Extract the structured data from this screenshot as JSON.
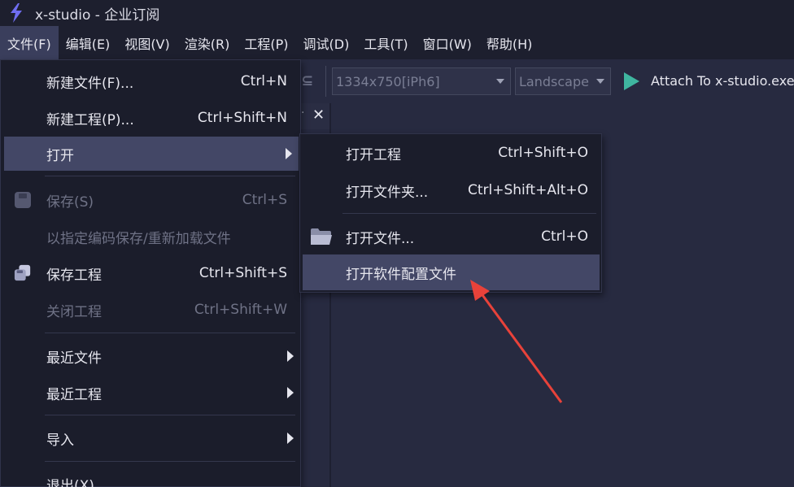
{
  "window": {
    "title": "x-studio - 企业订阅"
  },
  "menubar": {
    "items": [
      {
        "label": "文件(F)"
      },
      {
        "label": "编辑(E)"
      },
      {
        "label": "视图(V)"
      },
      {
        "label": "渲染(R)"
      },
      {
        "label": "工程(P)"
      },
      {
        "label": "调试(D)"
      },
      {
        "label": "工具(T)"
      },
      {
        "label": "窗口(W)"
      },
      {
        "label": "帮助(H)"
      }
    ]
  },
  "toolbar": {
    "resolution_value": "1334x750[iPh6]",
    "orientation_value": "Landscape",
    "attach_label": "Attach To x-studio.exe"
  },
  "file_menu": {
    "items": [
      {
        "label": "新建文件(F)...",
        "shortcut": "Ctrl+N"
      },
      {
        "label": "新建工程(P)...",
        "shortcut": "Ctrl+Shift+N"
      },
      {
        "label": "打开",
        "shortcut": ""
      },
      {
        "label": "保存(S)",
        "shortcut": "Ctrl+S"
      },
      {
        "label": "以指定编码保存/重新加载文件",
        "shortcut": ""
      },
      {
        "label": "保存工程",
        "shortcut": "Ctrl+Shift+S"
      },
      {
        "label": "关闭工程",
        "shortcut": "Ctrl+Shift+W"
      },
      {
        "label": "最近文件",
        "shortcut": ""
      },
      {
        "label": "最近工程",
        "shortcut": ""
      },
      {
        "label": "导入",
        "shortcut": ""
      },
      {
        "label": "退出(X)",
        "shortcut": ""
      }
    ]
  },
  "open_submenu": {
    "items": [
      {
        "label": "打开工程",
        "shortcut": "Ctrl+Shift+O"
      },
      {
        "label": "打开文件夹...",
        "shortcut": "Ctrl+Shift+Alt+O"
      },
      {
        "label": "打开文件...",
        "shortcut": "Ctrl+O"
      },
      {
        "label": "打开软件配置文件",
        "shortcut": ""
      }
    ]
  },
  "colors": {
    "menu_bg": "#1b1d2b",
    "highlight": "#434766",
    "accent_play": "#3fb6a0",
    "annotation_arrow": "#e8423a"
  }
}
